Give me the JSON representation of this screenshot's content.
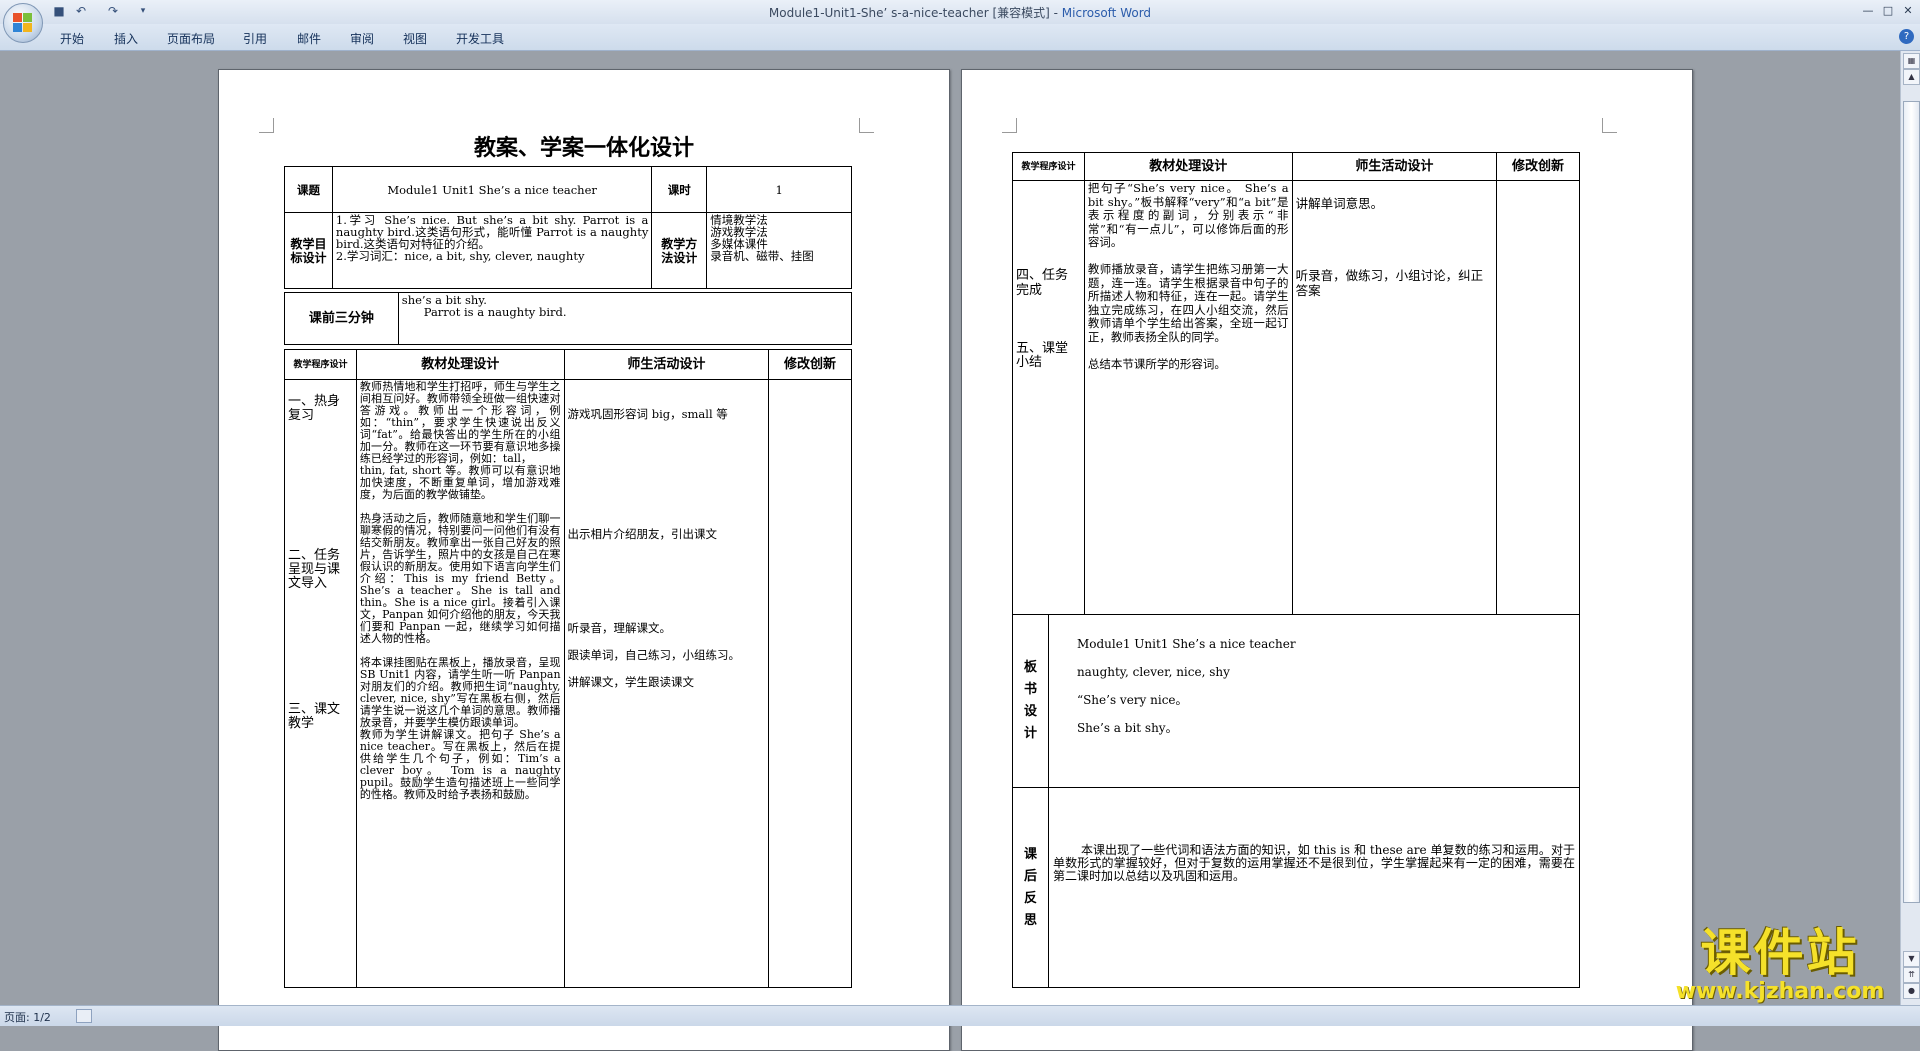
{
  "window": {
    "doc_name": "Module1-Unit1-She’ s-a-nice-teacher [兼容模式]",
    "separator": " - ",
    "app_name": "Microsoft Word"
  },
  "ribbon": {
    "tabs": [
      "开始",
      "插入",
      "页面布局",
      "引用",
      "邮件",
      "审阅",
      "视图",
      "开发工具"
    ]
  },
  "status": {
    "page_count": "页面: 1/2"
  },
  "watermark": {
    "title": "课件站",
    "url": "www.kjzhan.com"
  },
  "page1": {
    "heading": "教案、学案一体化设计",
    "topic_label": "课题",
    "topic_value": "Module1 Unit1 She’s a nice teacher",
    "period_label": "课时",
    "period_value": "1",
    "goals_label": "教学目标设计",
    "goals_text": "1.学习 She’s nice. But she’s a bit shy. Parrot is a naughty bird.这类语句形式，能听懂 Parrot is a naughty bird.这类语句对特征的介绍。\n2.学习词汇：nice, a bit, shy, clever, naughty",
    "methods_label": "教学方法设计",
    "methods_text": "情境教学法\n游戏教学法\n多媒体课件\n录音机、磁带、挂图",
    "warmup_label": "课前三分钟",
    "warmup_text": "she’s a bit shy.\n      Parrot is a naughty bird.",
    "col_headers": [
      "教学程序设计",
      "教材处理设计",
      "师生活动设计",
      "修改创新"
    ],
    "procedure_text": "\n一、热身复习\n\n\n\n\n\n\n\n\n\n二、任务呈现与课文导入\n\n\n\n\n\n\n\n\n三、课文教学",
    "material_text": "教师热情地和学生打招呼，师生与学生之间相互问好。教师带领全班做一组快速对答游戏。教师出一个形容词，例如：“thin”，要求学生快速说出反义词“fat”。给最快答出的学生所在的小组加一分。教师在这一环节要有意识地多操练已经学过的形容词，例如：tall，\nthin, fat, short 等。教师可以有意识地加快速度，不断重复单词，增加游戏难度，为后面的教学做铺垫。\n\n热身活动之后，教师随意地和学生们聊一聊寒假的情况，特别要问一问他们有没有结交新朋友。教师拿出一张自己好友的照片，告诉学生，照片中的女孩是自己在寒假认识的新朋友。使用如下语言向学生们介绍：This is my friend Betty。She’s a teacher。She is tall and thin。She is a nice girl。接着引入课文，Panpan 如何介绍他的朋友，今天我们要和 Panpan 一起，继续学习如何描述人物的性格。\n\n将本课挂图贴在黑板上，播放录音，呈现 SB Unit1 内容，请学生听一听 Panpan 对朋友们的介绍。教师把生词“naughty, clever, nice, shy”写在黑板右侧，然后请学生说一说这几个单词的意思。教师播放录音，并要学生模仿跟读单词。\n教师为学生讲解课文。把句子 She’s a nice teacher。写在黑板上，然后在提供给学生几个句子，例如：Tim’s a clever boy。 Tom is a naughty pupil。鼓励学生造句描述班上一些同学的性格。教师及时给予表扬和鼓励。",
    "activity_text": "\n\n游戏巩固形容词 big，small 等\n\n\n\n\n\n\n\n\n出示相片介绍朋友，引出课文\n\n\n\n\n\n\n听录音，理解课文。\n\n跟读单词，自己练习，小组练习。\n\n讲解课文，学生跟读课文",
    "innovation_text": ""
  },
  "page2": {
    "col_headers": [
      "教学程序设计",
      "教材处理设计",
      "师生活动设计",
      "修改创新"
    ],
    "procedure_text": "\n\n\n\n\n\n四、任务完成\n\n\n\n五、课堂小结",
    "material_text": "把句子“She’s very nice。 She’s a bit shy。”板书解释“very”和“a bit”是表示程度的副词，分别表示“非常”和“有一点儿”，可以修饰后面的形容词。\n\n教师播放录音，请学生把练习册第一大题，连一连。请学生根据录音中句子的所描述人物和特征，连在一起。请学生独立完成练习，在四人小组交流，然后教师请单个学生给出答案，全班一起订正，教师表扬全队的同学。\n\n总结本节课所学的形容词。",
    "activity_text": "\n讲解单词意思。\n\n\n\n\n听录音，做练习，小组讨论，纠正答案",
    "innovation_text": "",
    "board_label": "板书设计",
    "board_lines": [
      "Module1 Unit1 She’s a nice teacher",
      "naughty,   clever,   nice,  shy",
      "“She’s very nice。",
      " She’s a bit shy。"
    ],
    "reflection_label": "课后反思",
    "reflection_text": "本课出现了一些代词和语法方面的知识，如 this is 和 these are 单复数的练习和运用。对于单数形式的掌握较好，但对于复数的运用掌握还不是很到位，学生掌握起来有一定的困难，需要在第二课时加以总结以及巩固和运用。"
  },
  "colors": {
    "accent": "#2b5cab",
    "watermark": "#f5e12a"
  }
}
